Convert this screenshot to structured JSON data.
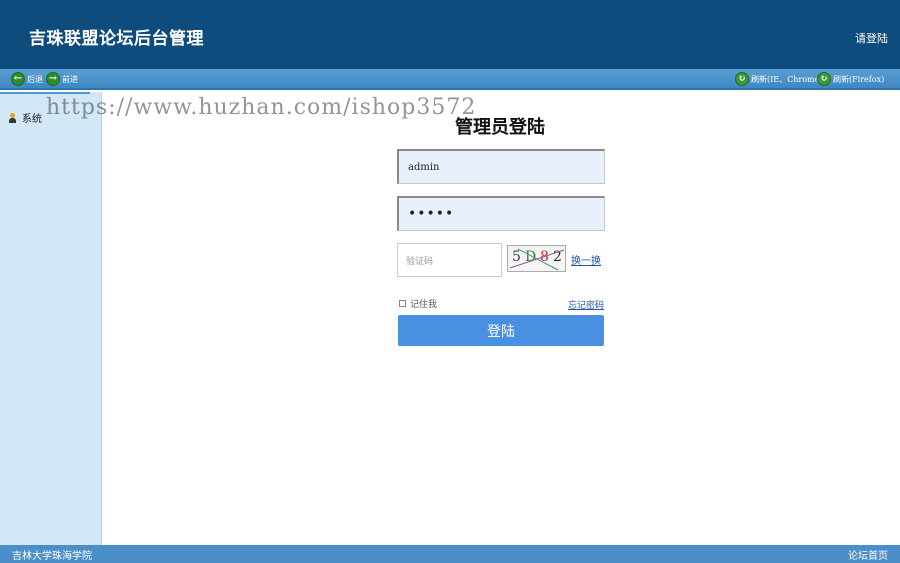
{
  "header": {
    "title": "吉珠联盟论坛后台管理",
    "login_link": "请登陆"
  },
  "toolbar": {
    "back": {
      "icon": "arrow-left-icon",
      "label": "后退"
    },
    "forward": {
      "icon": "arrow-right-icon",
      "label": "前进"
    },
    "refresh_ie": {
      "icon": "refresh-icon",
      "label": "刷新(IE、Chrome)"
    },
    "refresh_ff": {
      "icon": "refresh-icon",
      "label": "刷新(Firefox)"
    }
  },
  "sidebar": {
    "items": [
      {
        "label": "系统",
        "icon": "user-icon"
      }
    ]
  },
  "watermark": "https://www.huzhan.com/ishop3572",
  "login": {
    "title": "管理员登陆",
    "username": "admin",
    "password_mask": "•••••",
    "captcha_placeholder": "验证码",
    "captcha_chars": [
      "5",
      "D",
      "8",
      "2"
    ],
    "refresh_captcha": "换一换",
    "remember_label": "记住我",
    "forgot_label": "忘记密码",
    "submit_label": "登陆"
  },
  "footer": {
    "left": "吉林大学珠海学院",
    "right": "论坛首页"
  },
  "colors": {
    "header": "#0f4c7e",
    "toolbar": "#4a8fc8",
    "sidebar": "#d3e8f6",
    "button": "#4a90e2"
  }
}
